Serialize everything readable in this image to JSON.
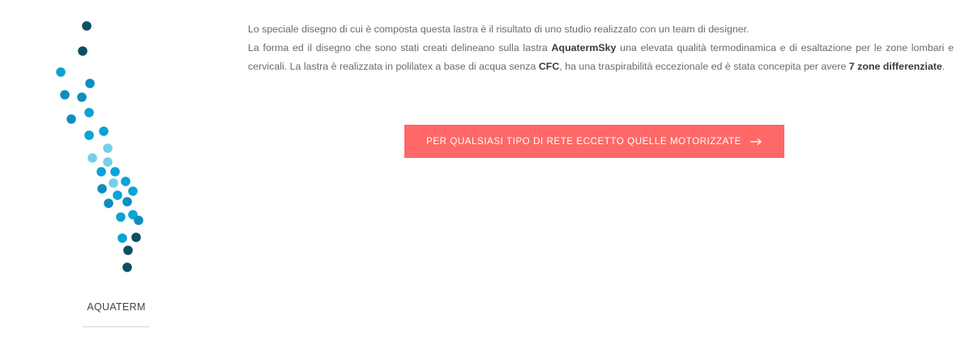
{
  "product": {
    "name": "AQUATERM",
    "dot_colors": {
      "dark": "#0b4f63",
      "mid": "#0b8fbf",
      "bright": "#0aa3d6",
      "light": "#75cfe8"
    }
  },
  "description": {
    "intro": "Lo speciale disegno di cui è composta questa lastra è il risultato di uno studio realizzato con un team di designer.",
    "part1": "La forma ed il disegno che sono stati creati delineano sulla lastra ",
    "brand": "AquatermSky",
    "part2": " una elevata qualità termodinamica e di esaltazione per le zone lombari e cervicali. La lastra è realizzata in polilatex a base di acqua senza ",
    "cfc": "CFC",
    "part3": ", ha una traspirabilità eccezionale ed è stata concepita per avere ",
    "zones": "7 zone differenziate",
    "end": "."
  },
  "cta": {
    "label": "PER QUALSIASI TIPO DI RETE ECCETTO QUELLE MOTORIZZATE",
    "icon": "arrow-right-icon",
    "color": "#fe6868"
  }
}
